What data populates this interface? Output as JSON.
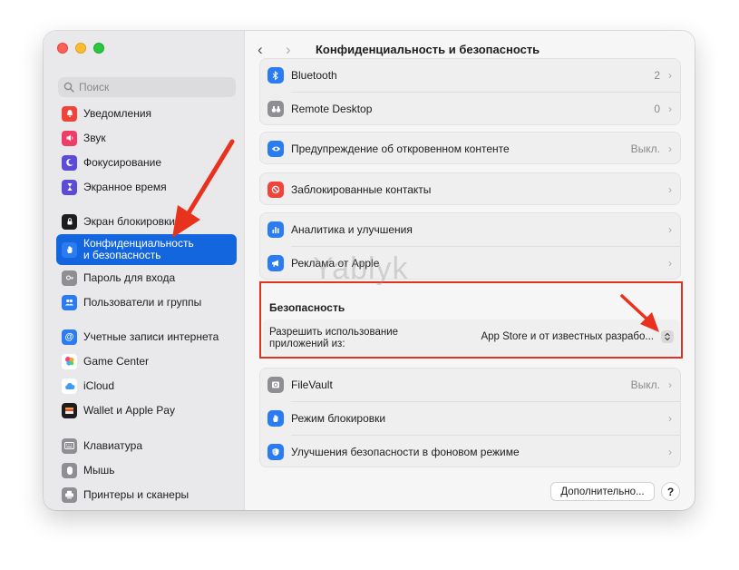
{
  "window": {
    "title": "Конфиденциальность и безопасность"
  },
  "search": {
    "placeholder": "Поиск"
  },
  "sidebar": {
    "items": [
      {
        "label": "Уведомления",
        "icon": "bell-icon",
        "color": "#f0443a"
      },
      {
        "label": "Звук",
        "icon": "speaker-icon",
        "color": "#ef3d6a"
      },
      {
        "label": "Фокусирование",
        "icon": "moon-icon",
        "color": "#5b4bd6"
      },
      {
        "label": "Экранное время",
        "icon": "hourglass-icon",
        "color": "#5b4bd6"
      },
      {
        "label": "Экран блокировки",
        "icon": "lock-screen-icon",
        "color": "#1d1d1f"
      },
      {
        "label": "Конфиденциальность\nи безопасность",
        "icon": "hand-icon",
        "color": "#2b7cf3",
        "selected": true
      },
      {
        "label": "Пароль для входа",
        "icon": "key-icon",
        "color": "#8e8e93"
      },
      {
        "label": "Пользователи и группы",
        "icon": "users-icon",
        "color": "#2b7cf3"
      },
      {
        "label": "Учетные записи интернета",
        "icon": "at-icon",
        "color": "#2b7cf3"
      },
      {
        "label": "Game Center",
        "icon": "game-center-icon",
        "color": "#f4a623"
      },
      {
        "label": "iCloud",
        "icon": "cloud-icon",
        "color": "#ffffff"
      },
      {
        "label": "Wallet и Apple Pay",
        "icon": "wallet-icon",
        "color": "#1d1d1f"
      },
      {
        "label": "Клавиатура",
        "icon": "keyboard-icon",
        "color": "#8e8e93"
      },
      {
        "label": "Мышь",
        "icon": "mouse-icon",
        "color": "#8e8e93"
      },
      {
        "label": "Принтеры и сканеры",
        "icon": "printer-icon",
        "color": "#8e8e93"
      }
    ]
  },
  "groups": {
    "g1": [
      {
        "label": "Bluetooth",
        "value": "2",
        "icon": "bluetooth-icon",
        "color": "#2b7cf3"
      },
      {
        "label": "Remote Desktop",
        "value": "0",
        "icon": "binoculars-icon",
        "color": "#8e8e93"
      }
    ],
    "g2": [
      {
        "label": "Предупреждение об откровенном контенте",
        "value": "Выкл.",
        "icon": "eye-icon",
        "color": "#2b7cf3"
      }
    ],
    "g3": [
      {
        "label": "Заблокированные контакты",
        "value": "",
        "icon": "blocked-icon",
        "color": "#f0443a"
      }
    ],
    "g4": [
      {
        "label": "Аналитика и улучшения",
        "value": "",
        "icon": "analytics-icon",
        "color": "#2b7cf3"
      },
      {
        "label": "Реклама от Apple",
        "value": "",
        "icon": "megaphone-icon",
        "color": "#2b7cf3"
      }
    ],
    "g5": [
      {
        "label": "FileVault",
        "value": "Выкл.",
        "icon": "safe-icon",
        "color": "#8e8e93"
      },
      {
        "label": "Режим блокировки",
        "value": "",
        "icon": "hand-icon",
        "color": "#2b7cf3"
      },
      {
        "label": "Улучшения безопасности в фоновом режиме",
        "value": "",
        "icon": "shield-icon",
        "color": "#2b7cf3"
      }
    ]
  },
  "security": {
    "heading": "Безопасность",
    "label": "Разрешить использование\nприложений из:",
    "selected_value": "App Store и от известных разрабо..."
  },
  "buttons": {
    "more": "Дополнительно...",
    "help": "?"
  },
  "watermark": "Yablyk",
  "colors": {
    "accent": "#1466df",
    "highlight_box": "#e0321f",
    "arrow": "#e8321e"
  }
}
